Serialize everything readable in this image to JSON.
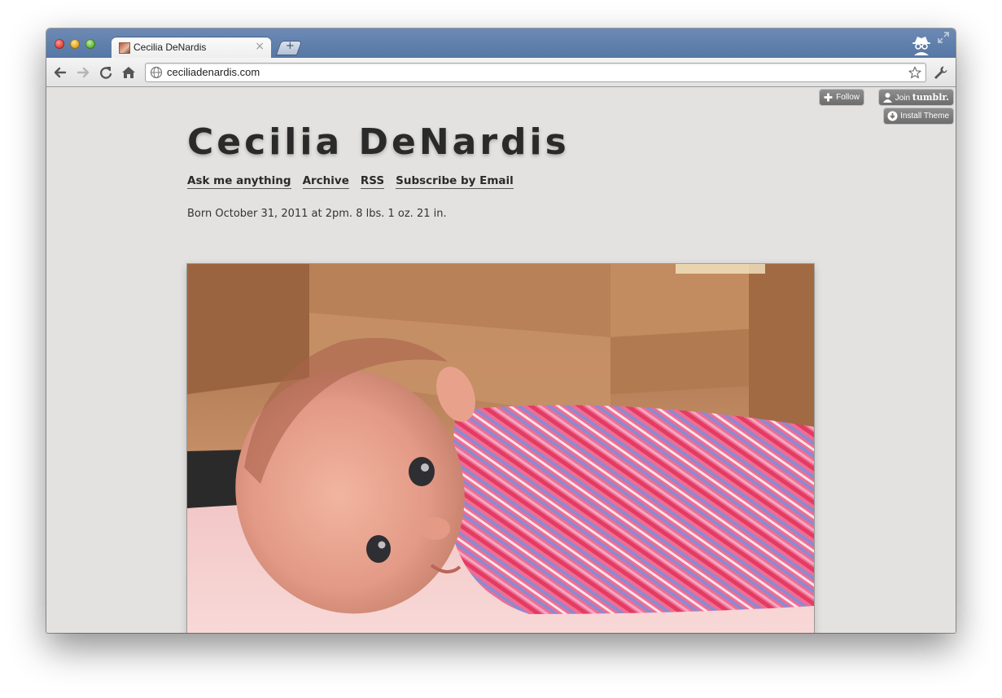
{
  "browser": {
    "tab": {
      "title": "Cecilia DeNardis",
      "close_glyph": "×"
    },
    "new_tab_glyph": "+",
    "url": "ceciliadenardis.com"
  },
  "tumblr_controls": {
    "follow_label": "Follow",
    "join_prefix": "Join",
    "join_brand": "tumblr.",
    "install_label": "Install Theme"
  },
  "blog": {
    "title": "Cecilia DeNardis",
    "nav": [
      "Ask me anything",
      "Archive",
      "RSS",
      "Subscribe by Email"
    ],
    "description": "Born October 31, 2011 at 2pm. 8 lbs. 1 oz. 21 in."
  },
  "icons": {
    "back": "back-arrow-icon",
    "forward": "forward-arrow-icon",
    "reload": "reload-icon",
    "home": "home-icon",
    "site": "globe-icon",
    "bookmark": "star-icon",
    "menu": "wrench-icon",
    "incognito": "incognito-icon"
  },
  "colors": {
    "titlebar": "#5677a5",
    "page_background": "#e3e2e0",
    "button_gray": "#7a7a7a"
  }
}
